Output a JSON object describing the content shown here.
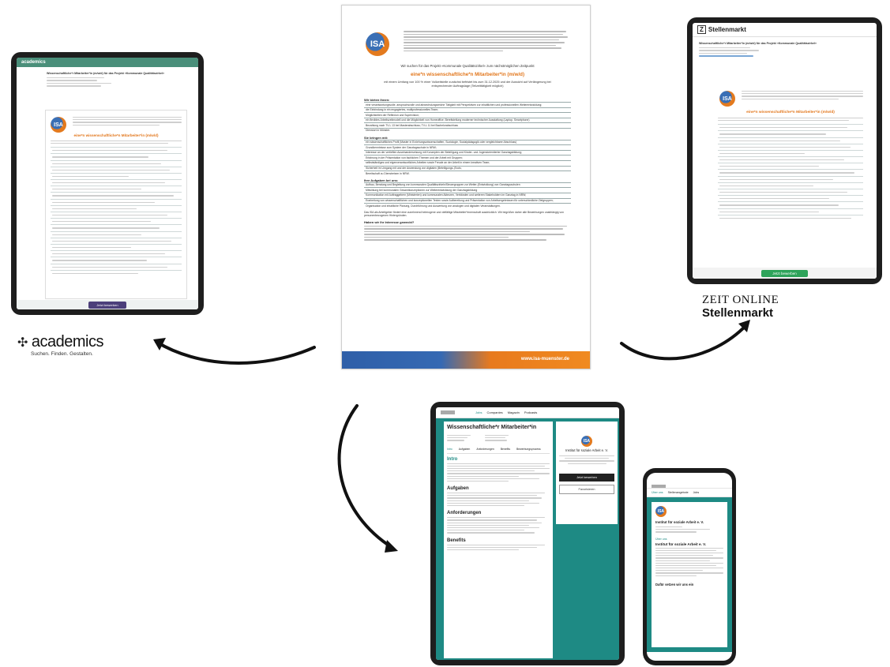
{
  "poster": {
    "logo_text": "ISA",
    "lead_in": "Wir suchen für das Projekt »Kommunale Qualitätszirkel« zum nächstmöglichen Zeitpunkt",
    "job_title": "eine*n wissenschaftliche*n Mitarbeiter*in (m/w/d)",
    "terms": "mit einem Umfang von 100 % einer Vollzeitstelle zunächst befristet bis zum 31.12.2025 und der Aussicht auf Verlängerung bei entsprechender Auftragslage (Teilzeittätigkeit möglich)",
    "offer_heading": "Wir bieten Ihnen:",
    "offer_items": [
      "eine verantwortungsvolle, anspruchsvolle und abwechslungsreiche Tätigkeit mit Perspektiven zur inhaltlichen und professionellen Weiterentwicklung;",
      "die Einbindung in ein engagiertes, multiprofessionelles Team;",
      "Möglichkeiten der Reflexion und Supervision;",
      "ein flexibles Arbeitszeitmodell und die Möglichkeit von Homeoffice; Bereitstellung moderner technischer Ausstattung (Laptop, Smartphone)",
      "Bezahlung nach TV-L 13 bei Masterabschluss; TV-L 11 bei Bachelorabschluss",
      "Dienstort in Münster."
    ],
    "bring_heading": "Sie bringen mit:",
    "bring_items": [
      "ein wissenschaftliches Profil (Master in Erziehungswissenschaften, Soziologie, Sozialpädagogik oder vergleichbarer Abschluss)",
      "Grundkenntnisse zum System der Ganztagsschule in NRW;",
      "Interesse an der vertieften Auseinandersetzung mit Konzepten der Beteiligung und Kinder- und Jugendorientierter Ganztagsbildung;",
      "Erfahrung in der Präsentation von fachlichen Themen und der Arbeit mit Gruppen;",
      "selbstständiges und eigenverantwortliches Arbeiten sowie Freude an der Arbeit in einem kreativen Team;",
      "Sicherheit im Umgang mit und der Anwendung von digitalen (Beteiligungs-)Tools;",
      "Bereitschaft zu Dienstreisen in NRW."
    ],
    "tasks_heading": "Ihre Aufgaben bei uns:",
    "tasks_items": [
      "Aufbau, Beratung und Begleitung von kommunalen Qualitätszirkeln/Steuergruppen zur Weiter-(Entwicklung) von Ganztagsschulen",
      "Mitwirkung bei kommunalen Gesamtkonzeptionen zur Weiterentwicklung der Ganztagsbildung",
      "Kommunikation mit Auftraggebern (Ministerien) und kommunalen Akteuren, Verbänden und weiteren Stakeholdern im Ganztag in NRW;",
      "Erarbeitung von wissenschaftlichen und konzeptionellen Texten sowie Aufbereitung und Präsentation von Arbeitsergebnissen für unterschiedliche Zielgruppen;",
      "Organisation und inhaltliche Planung, Durchführung und Auswertung von analogen und digitalen Veranstaltungen."
    ],
    "diversity_note": "Das ISA als Arbeitgeber fördert eine zunehmend heterogene und vielfältige Mitarbeiter*innenschaft ausdrücklich. Wir begrüßen daher alle Bewerbungen unabhängig von personenbezogenen Hintergründen.",
    "interest_heading": "Haben wir Ihr Interesse geweckt?",
    "footer_url": "www.isa-muenster.de"
  },
  "academics": {
    "brand": "academics",
    "tagline": "Suchen. Finden. Gestalten.",
    "ad_title": "Wissenschaftliche*r Mitarbeiter*in (m/w/d) für das Projekt »Kommunale Qualitätszirkel«",
    "ad_job_title": "eine*n wissenschaftliche*n Mitarbeiter*in (m/w/d)",
    "apply_button": "Jetzt bewerben"
  },
  "zeit": {
    "header": "Stellenmarkt",
    "logo_line1": "ZEIT ONLINE",
    "logo_line2": "Stellenmarkt",
    "ad_title": "Wissenschaftliche*r Mitarbeiter*in (m/w/d) für das Projekt »Kommunale Qualitätszirkel«",
    "ad_job_title": "eine*n wissenschaftliche*n Mitarbeiter*in (m/w/d)",
    "apply_button": "Jetzt bewerben"
  },
  "jobportal": {
    "nav": [
      "Jobs",
      "Companies",
      "Magazin",
      "Podcasts"
    ],
    "title": "Wissenschaftliche*r Mitarbeiter*in",
    "tabs": [
      "Intro",
      "Aufgaben",
      "Anforderungen",
      "Benefits",
      "Bewerbungsprozess"
    ],
    "section_intro": "Intro",
    "section_tasks": "Aufgaben",
    "section_requirements": "Anforderungen",
    "section_benefits": "Benefits",
    "company": "Institut für soziale Arbeit e. V.",
    "apply_button": "Jetzt bewerben",
    "follow_button": "Favorisieren"
  },
  "mobile": {
    "tabs": [
      "Über uns",
      "Stellenangebote",
      "Jobs"
    ],
    "company": "Institut für soziale Arbeit e. V.",
    "about_heading": "Über uns",
    "about_title": "Institut für soziale Arbeit e. V.",
    "bottom_label": "Dafür setzen wir uns ein"
  },
  "colors": {
    "isa_blue": "#2f5fa8",
    "isa_orange": "#e87a1e",
    "teal": "#1e8a84",
    "job_title_orange": "#e2761b",
    "academics_green": "#4a8f7a"
  }
}
